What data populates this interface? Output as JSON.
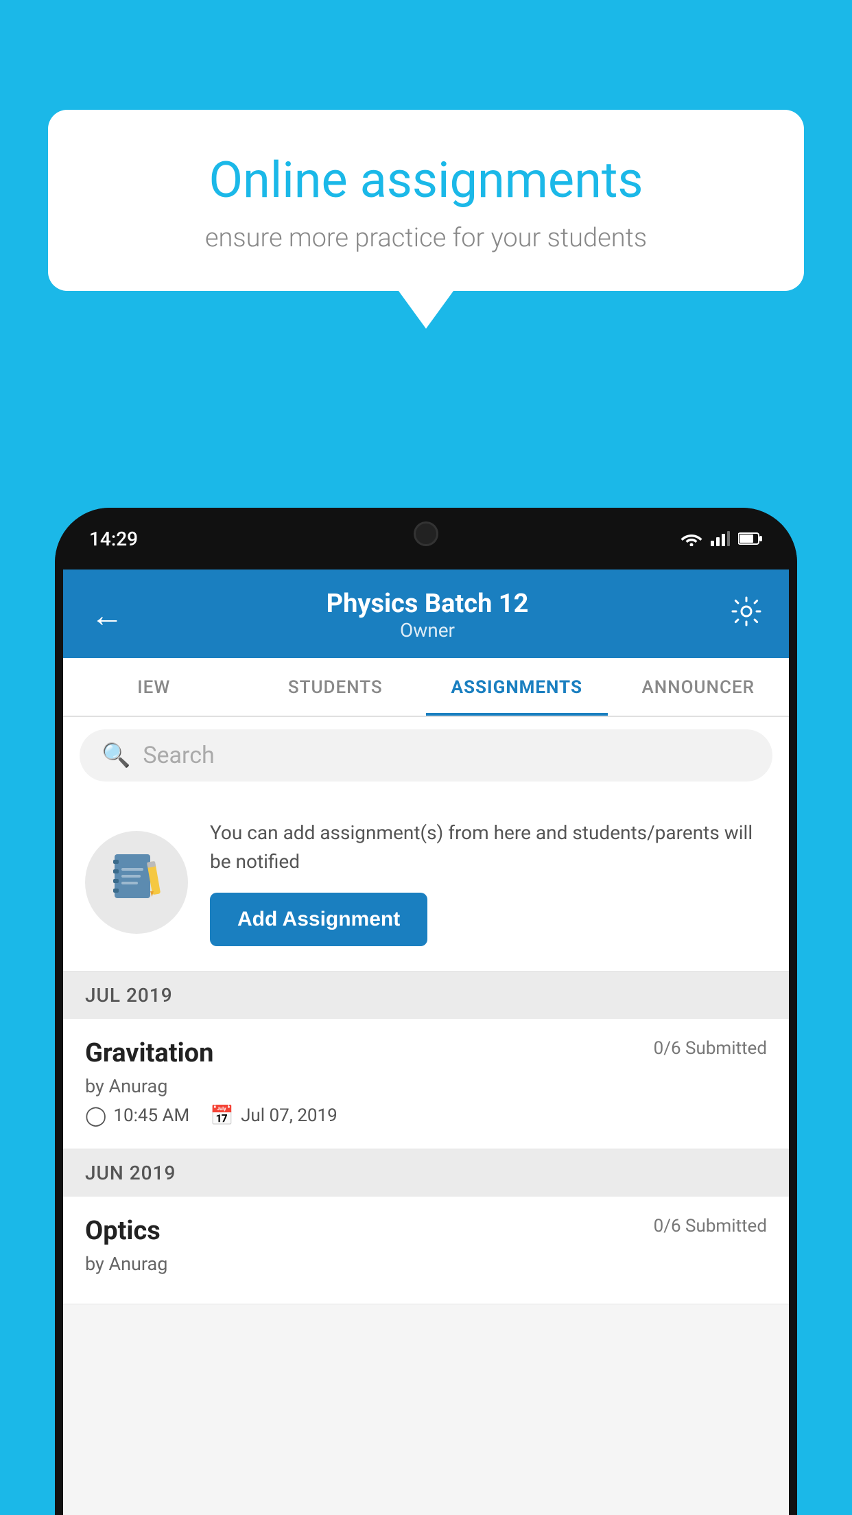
{
  "background_color": "#1BB8E8",
  "speech_bubble": {
    "title": "Online assignments",
    "subtitle": "ensure more practice for your students"
  },
  "status_bar": {
    "time": "14:29"
  },
  "app_header": {
    "title": "Physics Batch 12",
    "subtitle": "Owner"
  },
  "tabs": [
    {
      "label": "IEW",
      "active": false
    },
    {
      "label": "STUDENTS",
      "active": false
    },
    {
      "label": "ASSIGNMENTS",
      "active": true
    },
    {
      "label": "ANNOUNCER",
      "active": false
    }
  ],
  "search": {
    "placeholder": "Search"
  },
  "promo": {
    "description": "You can add assignment(s) from here and students/parents will be notified",
    "button_label": "Add Assignment"
  },
  "sections": [
    {
      "month": "JUL 2019",
      "assignments": [
        {
          "name": "Gravitation",
          "submitted": "0/6 Submitted",
          "by": "by Anurag",
          "time": "10:45 AM",
          "date": "Jul 07, 2019"
        }
      ]
    },
    {
      "month": "JUN 2019",
      "assignments": [
        {
          "name": "Optics",
          "submitted": "0/6 Submitted",
          "by": "by Anurag",
          "time": "",
          "date": ""
        }
      ]
    }
  ]
}
